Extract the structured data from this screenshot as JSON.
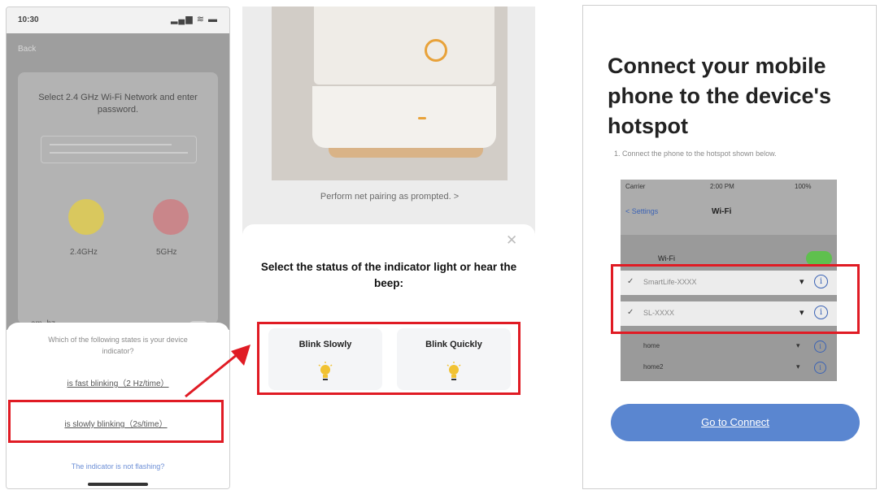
{
  "screen1": {
    "status_time": "10:30",
    "status_signal": "▂▄▆ ≋ ▬",
    "back_label": "Back",
    "wifi_title": "Select 2.4 GHz Wi-Fi Network and enter password.",
    "band_24_label": "2.4GHz",
    "band_5_label": "5GHz",
    "wifi_name": "am_bz",
    "question": "Which of the following states is your device indicator?",
    "option_fast": "is fast blinking（2 Hz/time）",
    "option_slow": "is slowly blinking（2s/time）",
    "help_link": "The indicator is not flashing?"
  },
  "screen2": {
    "perform_link": "Perform net pairing as prompted. >",
    "close_icon_glyph": "✕",
    "title": "Select the status of the indicator light or hear the beep:",
    "option_slow": "Blink Slowly",
    "option_quick": "Blink Quickly",
    "bulb_glyph": "💡"
  },
  "screen3": {
    "heading": "Connect your mobile phone to the device's hotspot",
    "step": "1. Connect the phone to the hotspot shown below.",
    "carrier": "Carrier",
    "status_time": "2:00 PM",
    "status_battery": "100%",
    "settings_back": "< Settings",
    "wifi_title": "Wi-Fi",
    "wifi_label": "Wi-Fi",
    "networks": [
      "SmartLife-XXXX",
      "SL-XXXX"
    ],
    "other_networks": [
      "home",
      "home2"
    ],
    "check_glyph": "✓",
    "signal_glyph": "▾",
    "info_glyph": "i",
    "connect_button": "Go to Connect"
  },
  "colors": {
    "highlight_red": "#e01b24",
    "primary_blue": "#5a86d0",
    "bulb_yellow": "#f1c232",
    "led_orange": "#e8a23a"
  },
  "icons": [
    "power-icon",
    "close-icon",
    "bulb-icon",
    "check-icon",
    "wifi-signal-icon",
    "info-icon",
    "arrow-icon"
  ]
}
